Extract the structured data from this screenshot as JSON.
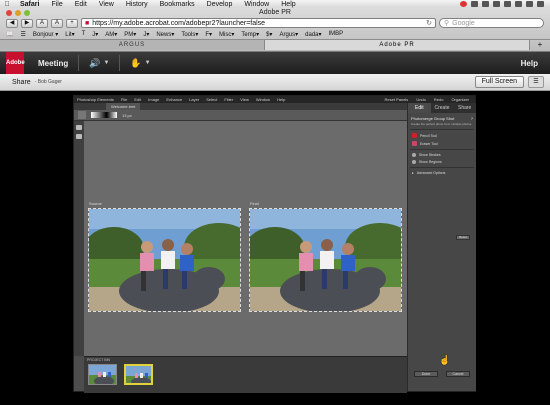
{
  "os_menubar": {
    "items": [
      "Safari",
      "File",
      "Edit",
      "View",
      "History",
      "Bookmarks",
      "Develop",
      "Window",
      "Help"
    ]
  },
  "browser": {
    "window_title": "Adobe PR",
    "url": "https://my.adobe.acrobat.com/adobepr2?launcher=false",
    "search_placeholder": "Google",
    "bookmarks": [
      "Bonjour ▾",
      "Lit▾",
      "T",
      "J▾",
      "AM▾",
      "PM▾",
      "J▾",
      "News▾",
      "Tools▾",
      "F▾",
      "Misc▾",
      "Temp▾",
      "$▾",
      "Argus▾",
      "dada▾",
      "IMBP"
    ],
    "tabs": [
      {
        "label": "ARGUS",
        "active": false
      },
      {
        "label": "Adobe PR",
        "active": true
      }
    ]
  },
  "connect": {
    "logo_text": "Adobe",
    "meeting_label": "Meeting",
    "help_label": "Help",
    "share_label": "Share",
    "presenter": "· Bob Gager",
    "fullscreen_label": "Full Screen"
  },
  "pse": {
    "menu_items": [
      "Photoshop Elements",
      "File",
      "Edit",
      "Image",
      "Enhance",
      "Layer",
      "Select",
      "Filter",
      "View",
      "Window",
      "Help"
    ],
    "menu_right": [
      "Reset Panels",
      "Undo",
      "Redo",
      "Organizer"
    ],
    "doc_tab": "Welcome.bmt",
    "option_size": "13 px",
    "source_label": "Source",
    "final_label": "Final",
    "panel_tabs": [
      "Edit",
      "Create",
      "Share"
    ],
    "panel_title": "Photomerge Group Shot",
    "panel_text": "Create the perfect photo from multiple photos.",
    "pencil_label": "Pencil Tool",
    "eraser_label": "Eraser Tool",
    "show_strokes": "Show Strokes",
    "show_regions": "Show Regions",
    "advanced": "Advanced Options",
    "reset_label": "Reset",
    "done_label": "Done",
    "cancel_label": "Cancel",
    "project_bin": "PROJECT BIN"
  }
}
